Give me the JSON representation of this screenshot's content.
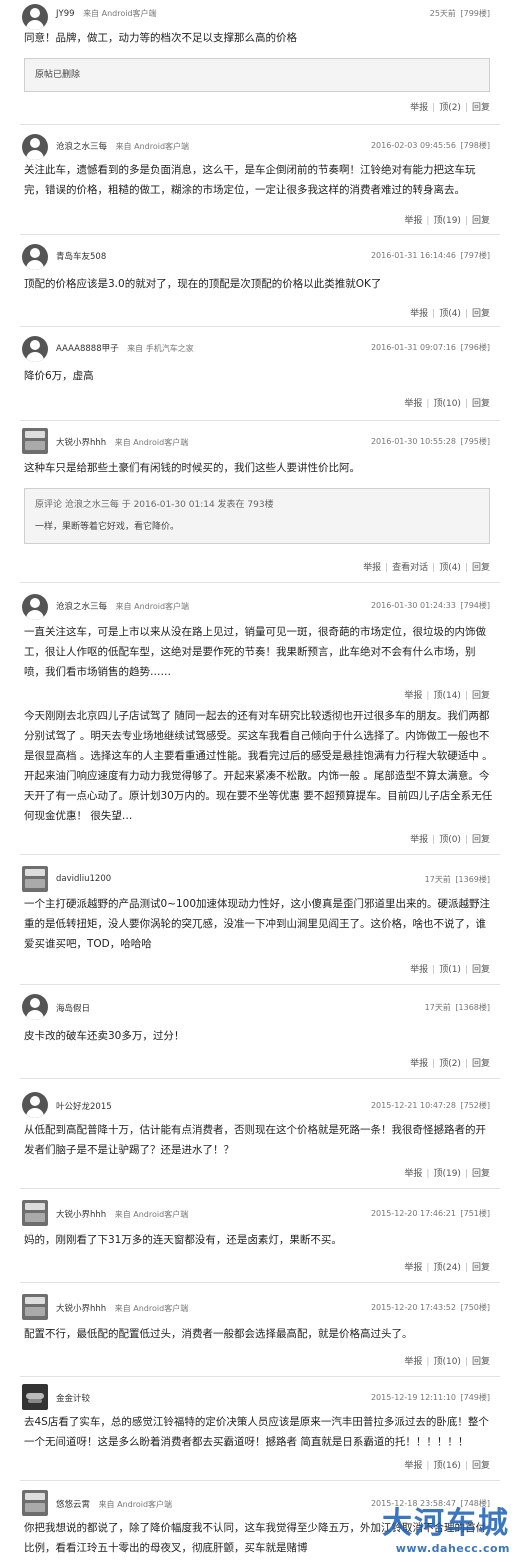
{
  "labels": {
    "report": "举报",
    "thread": "查看对话",
    "reply": "回复"
  },
  "posts": [
    {
      "user": "JY99",
      "from": "来自 Android客户端",
      "time": "25天前",
      "floor": "[799楼]",
      "body": "同意！品牌，做工，动力等的档次不足以支撑那么高的价格",
      "quote_body": "原帖已删除",
      "up": "顶(2)"
    },
    {
      "user": "沧浪之水三每",
      "from": "来自 Android客户端",
      "time": "2016-02-03 09:45:56",
      "floor": "[798楼]",
      "body": "关注此车，遗憾看到的多是负面消息，这么干，是车企倒闭前的节奏啊！江铃绝对有能力把这车玩完，错误的价格，粗糙的做工，糊涂的市场定位，一定让很多我这样的消费者难过的转身离去。",
      "up": "顶(19)"
    },
    {
      "user": "青岛车友508",
      "from": "",
      "time": "2016-01-31 16:14:46",
      "floor": "[797楼]",
      "body": "顶配的价格应该是3.0的就对了，现在的顶配是次顶配的价格以此类推就OK了",
      "up": "顶(4)"
    },
    {
      "user": "AAAA8888甲子",
      "from": "来自 手机汽车之家",
      "time": "2016-01-31 09:07:16",
      "floor": "[796楼]",
      "body": "降价6万，虚高",
      "up": "顶(10)"
    },
    {
      "user": "大锐小界hhh",
      "from": "来自 Android客户端",
      "time": "2016-01-30 10:55:28",
      "floor": "[795楼]",
      "body": "这种车只是给那些土豪们有闲钱的时候买的，我们这些人要讲性价比阿。",
      "quote_head": "原评论 沧浪之水三每 于 2016-01-30 01:14 发表在 793楼",
      "quote_body": "一样，果断等着它好戏，看它降价。",
      "up": "顶(4)"
    },
    {
      "user": "沧浪之水三每",
      "from": "来自 Android客户端",
      "time": "2016-01-30 01:24:33",
      "floor": "[794楼]",
      "body": "一直关注这车，可是上市以来从没在路上见过，销量可见一斑，很奇葩的市场定位，很垃圾的内饰做工，很让人作呕的低配车型，这绝对是要作死的节奏！我果断预言，此车绝对不会有什么市场，别喷，我们看市场销售的趋势……",
      "up": "顶(14)"
    },
    {
      "user": "",
      "from": "",
      "time": "",
      "floor": "",
      "body": "今天刚刚去北京四儿子店试驾了 随同一起去的还有对车研究比较透彻也开过很多车的朋友。我们两都分别试驾了 。明天去专业场地继续试驾感受。买这车我看自己倾向于什么选择了。内饰做工一般也不是很显高档 。选择这车的人主要看重通过性能。我看完过后的感受是悬挂饱满有力行程大软硬适中 。开起来油门响应速度有力动力我觉得够了。开起来紧凑不松散。内饰一般 。尾部造型不算太满意。今天开了有一点心动了。原计划30万内的。现在要不坐等优惠 要不超预算提车。目前四儿子店全系无任何现金优惠！ 很失望…",
      "up": "顶(0)"
    },
    {
      "user": "davidliu1200",
      "from": "",
      "time": "17天前",
      "floor": "[1369楼]",
      "body": "一个主打硬派越野的产品测试0~100加速体现动力性好，这小傻真是歪门邪道里出来的。硬派越野注重的是低转扭矩，没人要你涡轮的突兀感，没准一下冲到山涧里见阎王了。这价格，啥也不说了，谁爱买谁买吧，TOD，哈哈哈",
      "up": "顶(1)"
    },
    {
      "user": "海岛假日",
      "from": "",
      "time": "17天前",
      "floor": "[1368楼]",
      "body": "皮卡改的破车还卖30多万，过分！",
      "up": "顶(2)"
    },
    {
      "user": "叶公好龙2015",
      "from": "",
      "time": "2015-12-21 10:47:28",
      "floor": "[752楼]",
      "body": "从低配到高配普降十万，估计能有点消费者，否则现在这个价格就是死路一条！我很奇怪撼路者的开发者们脑子是不是让驴踢了？还是进水了！？",
      "up": "顶(19)"
    },
    {
      "user": "大锐小界hhh",
      "from": "来自 Android客户端",
      "time": "2015-12-20 17:46:21",
      "floor": "[751楼]",
      "body": "妈的，刚刚看了下31万多的连天窗都没有，还是卤素灯，果断不买。",
      "up": "顶(24)"
    },
    {
      "user": "大锐小界hhh",
      "from": "来自 Android客户端",
      "time": "2015-12-20 17:43:52",
      "floor": "[750楼]",
      "body": "配置不行，最低配的配置低过头，消费者一般都会选择最高配，就是价格高过头了。",
      "up": "顶(10)"
    },
    {
      "user": "金金计较",
      "from": "",
      "time": "2015-12-19 12:11:10",
      "floor": "[749楼]",
      "body": "去4S店看了实车，总的感觉江铃福特的定价决策人员应该是原来一汽丰田普拉多派过去的卧底！整个一个无间道呀！这是多么盼着消费者都去买霸道呀！撼路者 简直就是日系霸道的托！！！！！！",
      "up": "顶(16)"
    },
    {
      "user": "悠悠云霄",
      "from": "来自 Android客户端",
      "time": "2015-12-18 23:58:47",
      "floor": "[748楼]",
      "body": "你把我想说的都说了，除了降价幅度我不认同，这车我觉得至少降五万，外加江铃取消不合理的首付比例，看看江玲五十零出的母夜叉，彻底肝颤，买车就是赌博",
      "up": ""
    }
  ],
  "watermark": {
    "cn": "大河车城",
    "url": "www.dahecc.com"
  }
}
